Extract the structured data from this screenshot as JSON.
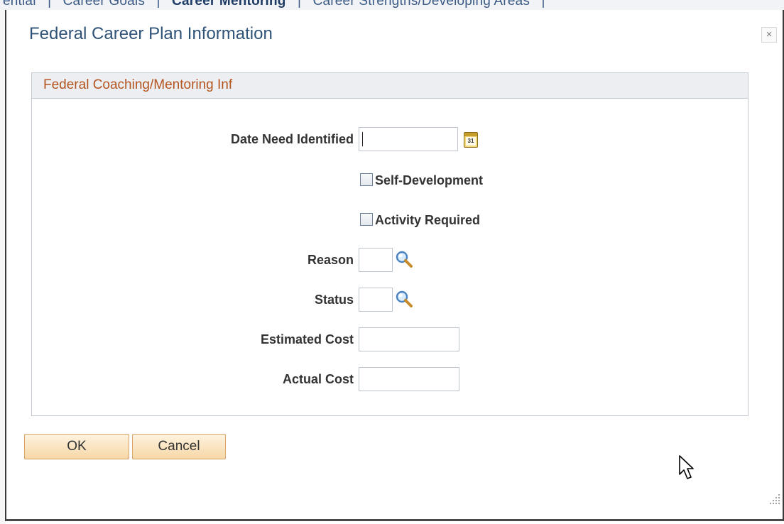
{
  "background": {
    "tabs_partial": [
      "ential",
      "Career Goals",
      "Career Mentoring",
      "Career Strengths/Developing Areas"
    ],
    "tab_separator": "|"
  },
  "modal": {
    "title": "Federal Career Plan Information",
    "close_glyph": "×",
    "section": {
      "header": "Federal Coaching/Mentoring Inf",
      "fields": {
        "date_need_identified": {
          "label": "Date Need Identified",
          "value": "",
          "calendar_day": "31"
        },
        "self_development": {
          "label": "Self-Development",
          "checked": false
        },
        "activity_required": {
          "label": "Activity Required",
          "checked": false
        },
        "reason": {
          "label": "Reason",
          "value": ""
        },
        "status": {
          "label": "Status",
          "value": ""
        },
        "estimated_cost": {
          "label": "Estimated Cost",
          "value": ""
        },
        "actual_cost": {
          "label": "Actual Cost",
          "value": ""
        }
      }
    },
    "buttons": {
      "ok": "OK",
      "cancel": "Cancel"
    }
  },
  "colors": {
    "title": "#2f5377",
    "section_header_text": "#b3541e",
    "button_gradient_top": "#fff3df",
    "button_gradient_bottom": "#f6d7a7"
  }
}
